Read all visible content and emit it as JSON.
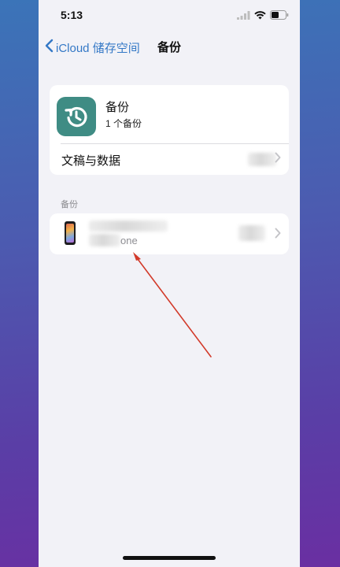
{
  "status_bar": {
    "time": "5:13"
  },
  "nav": {
    "back_label": "iCloud 储存空间",
    "title": "备份"
  },
  "backup_card": {
    "title": "备份",
    "subtitle": "1 个备份",
    "docs_label": "文稿与数据",
    "icon": "backup-restore-icon",
    "icon_color": "#3f8c84"
  },
  "section": {
    "header": "备份"
  },
  "device": {
    "subtitle_partial": "one",
    "icon": "iphone-icon"
  },
  "colors": {
    "accent": "#3478c6",
    "annotation_arrow": "#d23a2a"
  }
}
